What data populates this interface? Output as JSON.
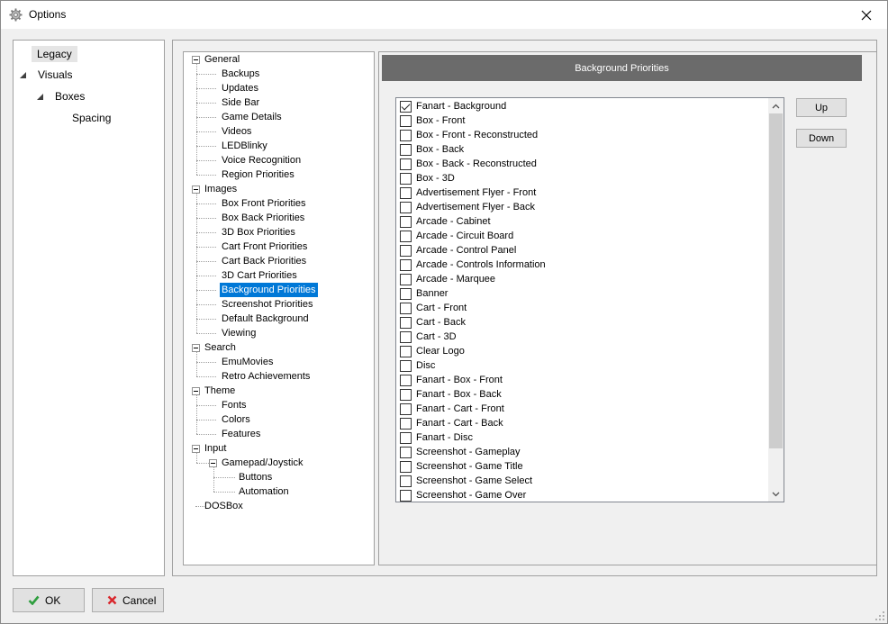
{
  "window": {
    "title": "Options",
    "app_icon": "gear-icon",
    "close_icon": "close-icon"
  },
  "nav": {
    "items": [
      {
        "label": "Legacy",
        "selected": true
      },
      {
        "label": "Visuals",
        "expanded": true
      },
      {
        "label": "Boxes",
        "expanded": true
      },
      {
        "label": "Spacing"
      }
    ]
  },
  "tree": {
    "groups": [
      {
        "label": "General",
        "children": [
          "Backups",
          "Updates",
          "Side Bar",
          "Game Details",
          "Videos",
          "LEDBlinky",
          "Voice Recognition",
          "Region Priorities"
        ]
      },
      {
        "label": "Images",
        "children": [
          "Box Front Priorities",
          "Box Back Priorities",
          "3D Box Priorities",
          "Cart Front Priorities",
          "Cart Back Priorities",
          "3D Cart Priorities",
          "Background Priorities",
          "Screenshot Priorities",
          "Default Background",
          "Viewing"
        ]
      },
      {
        "label": "Search",
        "children": [
          "EmuMovies",
          "Retro Achievements"
        ]
      },
      {
        "label": "Theme",
        "children": [
          "Fonts",
          "Colors",
          "Features"
        ]
      },
      {
        "label": "Input",
        "children": [
          "Gamepad/Joystick"
        ],
        "sub": [
          "Buttons",
          "Automation"
        ]
      },
      {
        "label": "DOSBox",
        "children": []
      }
    ],
    "selected": "Background Priorities"
  },
  "content": {
    "header": "Background Priorities",
    "items": [
      {
        "label": "Fanart - Background",
        "checked": true
      },
      {
        "label": "Box - Front",
        "checked": false
      },
      {
        "label": "Box - Front - Reconstructed",
        "checked": false
      },
      {
        "label": "Box - Back",
        "checked": false
      },
      {
        "label": "Box - Back - Reconstructed",
        "checked": false
      },
      {
        "label": "Box - 3D",
        "checked": false
      },
      {
        "label": "Advertisement Flyer - Front",
        "checked": false
      },
      {
        "label": "Advertisement Flyer - Back",
        "checked": false
      },
      {
        "label": "Arcade - Cabinet",
        "checked": false
      },
      {
        "label": "Arcade - Circuit Board",
        "checked": false
      },
      {
        "label": "Arcade - Control Panel",
        "checked": false
      },
      {
        "label": "Arcade - Controls Information",
        "checked": false
      },
      {
        "label": "Arcade - Marquee",
        "checked": false
      },
      {
        "label": "Banner",
        "checked": false
      },
      {
        "label": "Cart - Front",
        "checked": false
      },
      {
        "label": "Cart - Back",
        "checked": false
      },
      {
        "label": "Cart - 3D",
        "checked": false
      },
      {
        "label": "Clear Logo",
        "checked": false
      },
      {
        "label": "Disc",
        "checked": false
      },
      {
        "label": "Fanart - Box - Front",
        "checked": false
      },
      {
        "label": "Fanart - Box - Back",
        "checked": false
      },
      {
        "label": "Fanart - Cart - Front",
        "checked": false
      },
      {
        "label": "Fanart - Cart - Back",
        "checked": false
      },
      {
        "label": "Fanart - Disc",
        "checked": false
      },
      {
        "label": "Screenshot - Gameplay",
        "checked": false
      },
      {
        "label": "Screenshot - Game Title",
        "checked": false
      },
      {
        "label": "Screenshot - Game Select",
        "checked": false
      },
      {
        "label": "Screenshot - Game Over",
        "checked": false
      }
    ],
    "up_label": "Up",
    "down_label": "Down"
  },
  "footer": {
    "ok_label": "OK",
    "cancel_label": "Cancel",
    "ok_icon": "checkmark-icon",
    "cancel_icon": "x-icon",
    "ok_color": "#2e9e3e",
    "cancel_color": "#d9262c"
  },
  "colors": {
    "selection": "#0078d7",
    "header_bg": "#6b6b6b"
  }
}
